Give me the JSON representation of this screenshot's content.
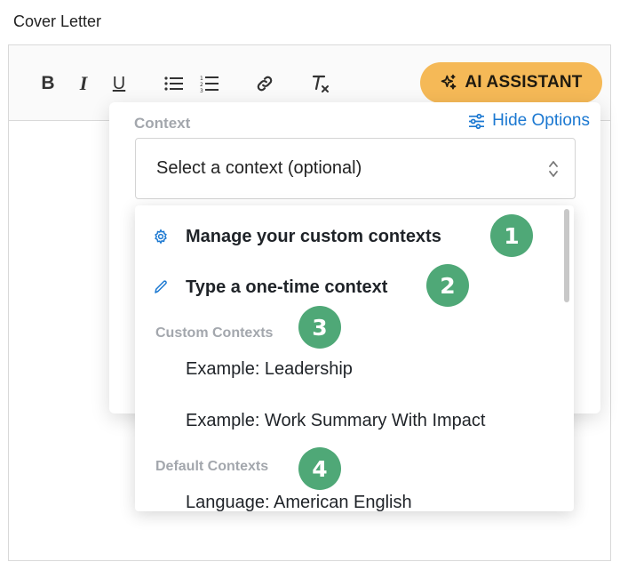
{
  "field_label": "Cover Letter",
  "toolbar": {
    "bold": "B",
    "italic": "I",
    "underline": "U",
    "ai_button_label": "AI ASSISTANT"
  },
  "context_panel": {
    "label": "Context",
    "hide_options": "Hide Options",
    "select_placeholder": "Select a context (optional)"
  },
  "dropdown": {
    "actions": [
      {
        "label": "Manage your custom contexts",
        "icon": "gear-icon"
      },
      {
        "label": "Type a one-time context",
        "icon": "pencil-icon"
      }
    ],
    "custom_header": "Custom Contexts",
    "custom_items": [
      "Example: Leadership",
      "Example: Work Summary With Impact"
    ],
    "default_header": "Default Contexts",
    "default_items": [
      "Language: American English"
    ]
  },
  "badges": [
    "1",
    "2",
    "3",
    "4"
  ],
  "colors": {
    "ai_button": "#f5b957",
    "badge": "#4fa877",
    "link": "#1b78d1"
  }
}
